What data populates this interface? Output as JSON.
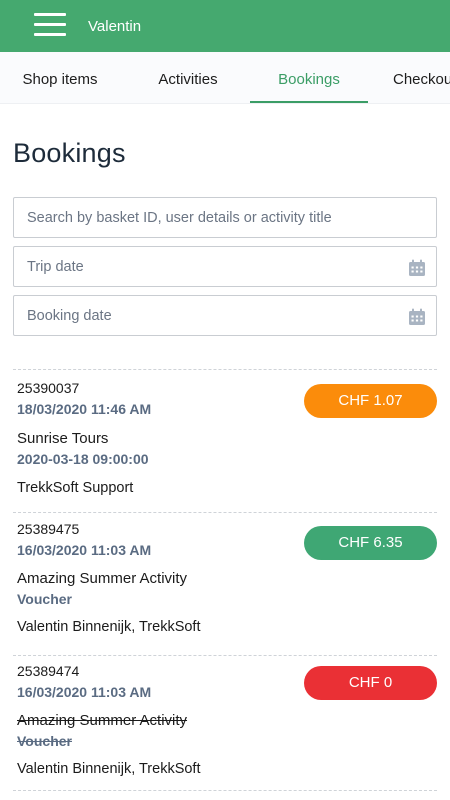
{
  "appbar": {
    "title": "Valentin"
  },
  "tabs": [
    {
      "label": "Shop items"
    },
    {
      "label": "Activities"
    },
    {
      "label": "Bookings"
    },
    {
      "label": "Checkout"
    }
  ],
  "active_tab": "Bookings",
  "page": {
    "title": "Bookings"
  },
  "filters": {
    "search_placeholder": "Search by basket ID, user details or activity title",
    "trip_date_placeholder": "Trip date",
    "booking_date_placeholder": "Booking date"
  },
  "colors": {
    "appbar": "#45a96f",
    "tab_active": "#3b9d66",
    "status_orange": "#fb8c0b",
    "status_green": "#3fa774",
    "status_red": "#ea3035"
  },
  "bookings": [
    {
      "id": "25390037",
      "booked_at": "18/03/2020 11:46 AM",
      "title": "Sunrise Tours",
      "detail": "2020-03-18 09:00:00",
      "customer": "TrekkSoft Support",
      "amount": "CHF 1.07",
      "status": "orange",
      "cancelled": false
    },
    {
      "id": "25389475",
      "booked_at": "16/03/2020 11:03 AM",
      "title": "Amazing Summer Activity",
      "detail": "Voucher",
      "customer": "Valentin Binnenijk, TrekkSoft",
      "amount": "CHF 6.35",
      "status": "green",
      "cancelled": false
    },
    {
      "id": "25389474",
      "booked_at": "16/03/2020 11:03 AM",
      "title": "Amazing Summer Activity",
      "detail": "Voucher",
      "customer": "Valentin Binnenijk, TrekkSoft",
      "amount": "CHF 0",
      "status": "red",
      "cancelled": true
    }
  ]
}
